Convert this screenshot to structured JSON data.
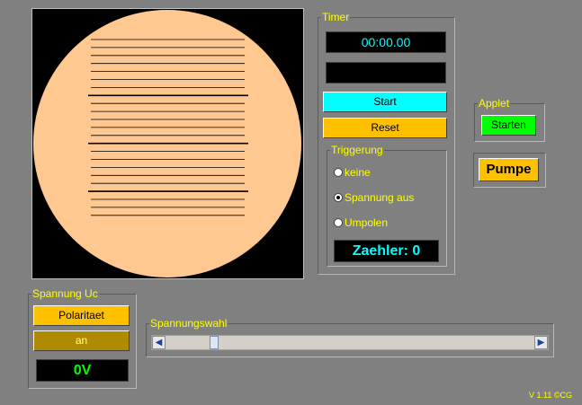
{
  "timer": {
    "legend": "Timer",
    "time": "00:00.00",
    "start_label": "Start",
    "reset_label": "Reset"
  },
  "triggering": {
    "legend": "Triggerung",
    "options": [
      {
        "label": "keine",
        "checked": false
      },
      {
        "label": "Spannung aus",
        "checked": true
      },
      {
        "label": "Umpolen",
        "checked": false
      }
    ],
    "counter": "Zaehler: 0"
  },
  "applet": {
    "legend": "Applet",
    "start_label": "Starten"
  },
  "pump": {
    "label": "Pumpe"
  },
  "voltage": {
    "legend": "Spannung Uc",
    "polarity_label": "Polaritaet",
    "on_label": "an",
    "value": "0V"
  },
  "voltage_select": {
    "legend": "Spannungswahl",
    "slider_fraction": 0.12
  },
  "version": "V 1.11 ©CG",
  "colors": {
    "accent": "#ffff00",
    "button_orange": "#ffc000",
    "cyan": "#00ffff",
    "green": "#00ff00",
    "disk": "#ffc890"
  }
}
